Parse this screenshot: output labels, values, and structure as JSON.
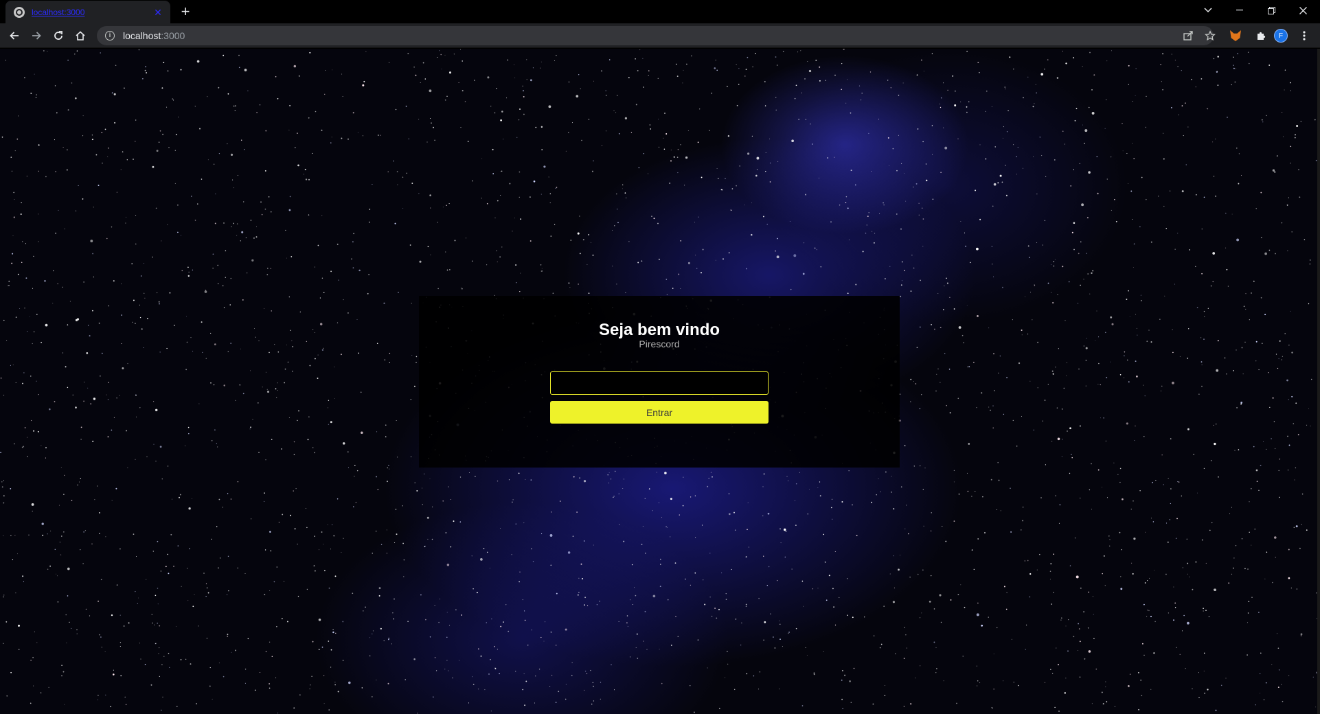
{
  "browser": {
    "tab": {
      "title": "localhost:3000"
    },
    "address": {
      "host": "localhost",
      "port": ":3000"
    },
    "profile_initial": "F"
  },
  "login": {
    "title": "Seja bem vindo",
    "subtitle": "Pirescord",
    "input_value": "",
    "button_label": "Entrar"
  },
  "colors": {
    "accent": "#eef22a",
    "panel_bg": "#000000",
    "sky": "#05050d",
    "nebula": "#2a2ad0"
  }
}
